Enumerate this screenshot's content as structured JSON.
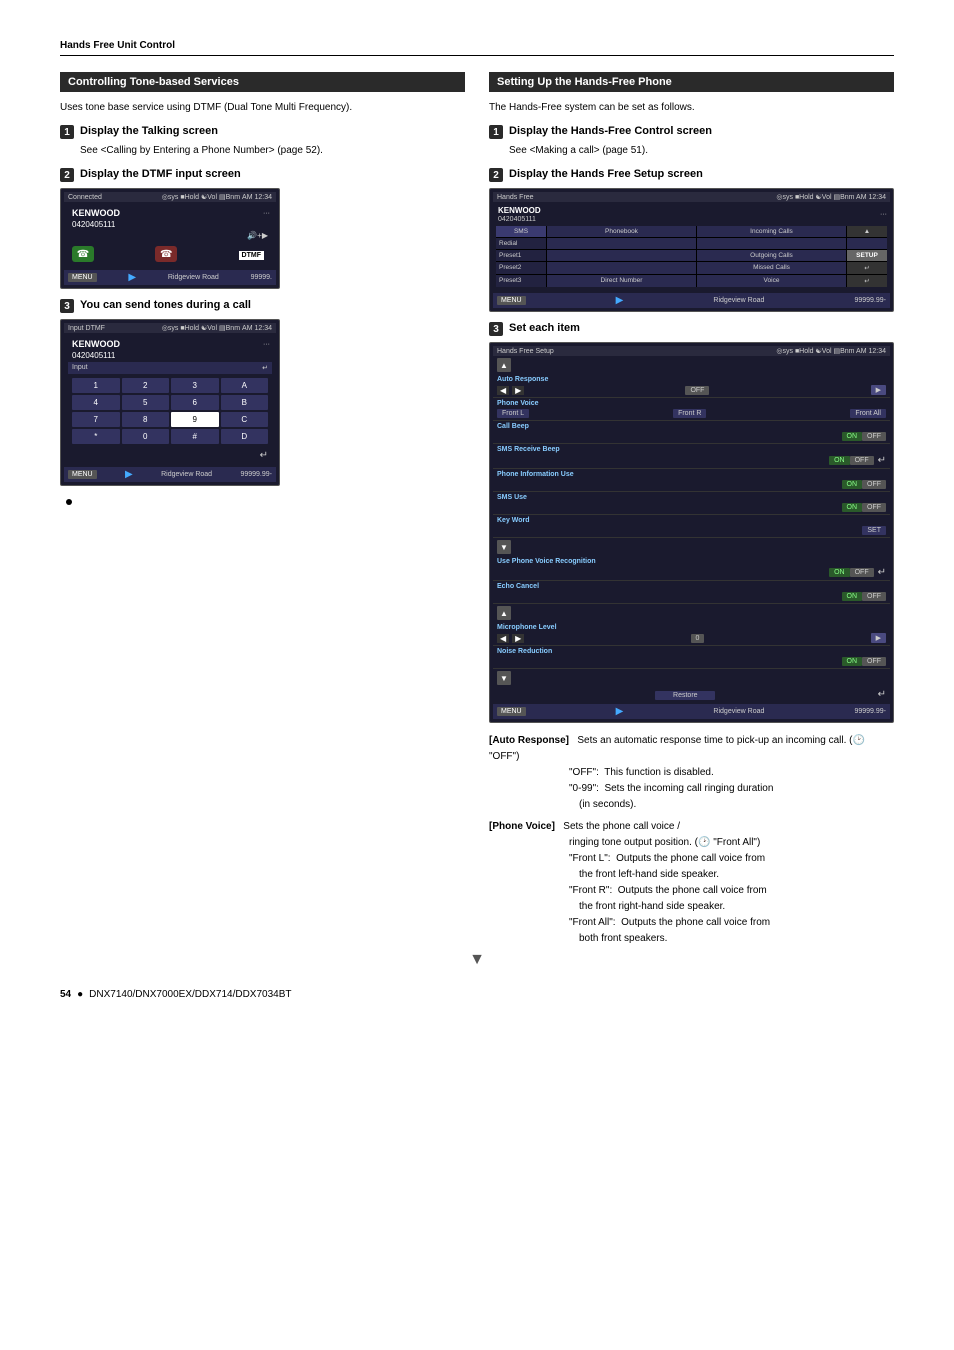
{
  "header": {
    "title": "Hands Free Unit Control"
  },
  "left_section": {
    "title": "Controlling Tone-based Services",
    "intro": "Uses tone base service using DTMF (Dual Tone Multi Frequency).",
    "step1": {
      "num": "1",
      "label": "Display the Talking screen",
      "desc": "See <Calling by Entering a Phone Number> (page 52)."
    },
    "step2": {
      "num": "2",
      "label": "Display the DTMF input screen",
      "screen1": {
        "status": "Connected",
        "time": "AM 12:34",
        "caller": "KENWOOD",
        "number": "0420405111",
        "dtmf_label": "DTMF"
      }
    },
    "step3": {
      "num": "3",
      "label": "You can send tones during a call",
      "screen2": {
        "status": "Input DTMF",
        "time": "AM 12:34",
        "caller": "KENWOOD",
        "number": "0420405111",
        "keys": [
          "1",
          "2",
          "3",
          "A",
          "4",
          "5",
          "6",
          "B",
          "7",
          "8",
          "9",
          "C",
          "*",
          "0",
          "#",
          "D"
        ]
      }
    }
  },
  "right_section": {
    "title": "Setting Up the Hands-Free Phone",
    "intro": "The Hands-Free system can be set as follows.",
    "step1": {
      "num": "1",
      "label": "Display the Hands-Free Control screen",
      "desc": "See <Making a call> (page 51)."
    },
    "step2": {
      "num": "2",
      "label": "Display the Hands Free Setup screen",
      "screen": {
        "title": "Hands Free",
        "time": "AM 12:34",
        "caller": "KENWOOD",
        "number": "0420405111",
        "rows": [
          [
            "SMS",
            "Phonebook",
            "Incoming Calls",
            ""
          ],
          [
            "Redial",
            "",
            "",
            ""
          ],
          [
            "Preset1",
            "",
            "Outgoing Calls",
            "SETUP"
          ],
          [
            "Preset2",
            "",
            "Missed Calls",
            ""
          ],
          [
            "Preset3",
            "Direct Number",
            "Voice",
            ""
          ]
        ],
        "bottom": "Ridgeview Road",
        "price": "99999.99"
      }
    },
    "step3": {
      "num": "3",
      "label": "Set each item",
      "setup_screen": {
        "title": "Hands Free Setup",
        "time": "AM 12:34",
        "sections": [
          {
            "label": "Auto Response",
            "type": "arrow_value",
            "value": "OFF"
          },
          {
            "label": "Phone Voice",
            "sub_buttons": [
              "Front L",
              "Front R",
              "Front All"
            ]
          },
          {
            "label": "Call Beep",
            "buttons": [
              "ON",
              "OFF"
            ]
          },
          {
            "label": "SMS Receive Beep",
            "buttons": [
              "ON",
              "OFF"
            ],
            "has_return": true
          },
          {
            "label": "Phone Information Use",
            "buttons": [
              "ON",
              "OFF"
            ]
          },
          {
            "label": "SMS Use",
            "buttons": [
              "ON",
              "OFF"
            ]
          },
          {
            "label": "Key Word",
            "buttons": [
              "SET"
            ]
          },
          {
            "label": "Use Phone Voice Recognition",
            "buttons": [
              "ON",
              "OFF"
            ],
            "has_return": true
          },
          {
            "label": "Echo Cancel",
            "buttons": [
              "ON",
              "OFF"
            ]
          },
          {
            "label": "Microphone Level",
            "type": "arrow_value",
            "value": "0"
          },
          {
            "label": "Noise Reduction",
            "buttons": [
              "ON",
              "OFF"
            ]
          }
        ],
        "restore_label": "Restore",
        "bottom": "Ridgeview Road",
        "price": "99999.99"
      }
    }
  },
  "explanations": [
    {
      "key": "Auto Response",
      "desc": "Sets an automatic response time to pick-up an incoming call. (",
      "icon": "OFF",
      "suffix": "\"OFF\")",
      "details": [
        "\"OFF\": This function is disabled.",
        "\"0-99\": Sets the incoming call ringing duration (in seconds)."
      ]
    },
    {
      "key": "Phone Voice",
      "desc": "Sets the phone call voice / ringing tone output position. (",
      "icon": "Front All",
      "suffix": "\"Front All\")",
      "details": [
        "\"Front L\": Outputs the phone call voice from the front left-hand side speaker.",
        "\"Front R\": Outputs the phone call voice from the front right-hand side speaker.",
        "\"Front All\": Outputs the phone call voice from both front speakers."
      ]
    }
  ],
  "footer": {
    "page_num": "54",
    "dot": "●",
    "model": "DNX7140/DNX7000EX/DDX714/DDX7034BT"
  }
}
